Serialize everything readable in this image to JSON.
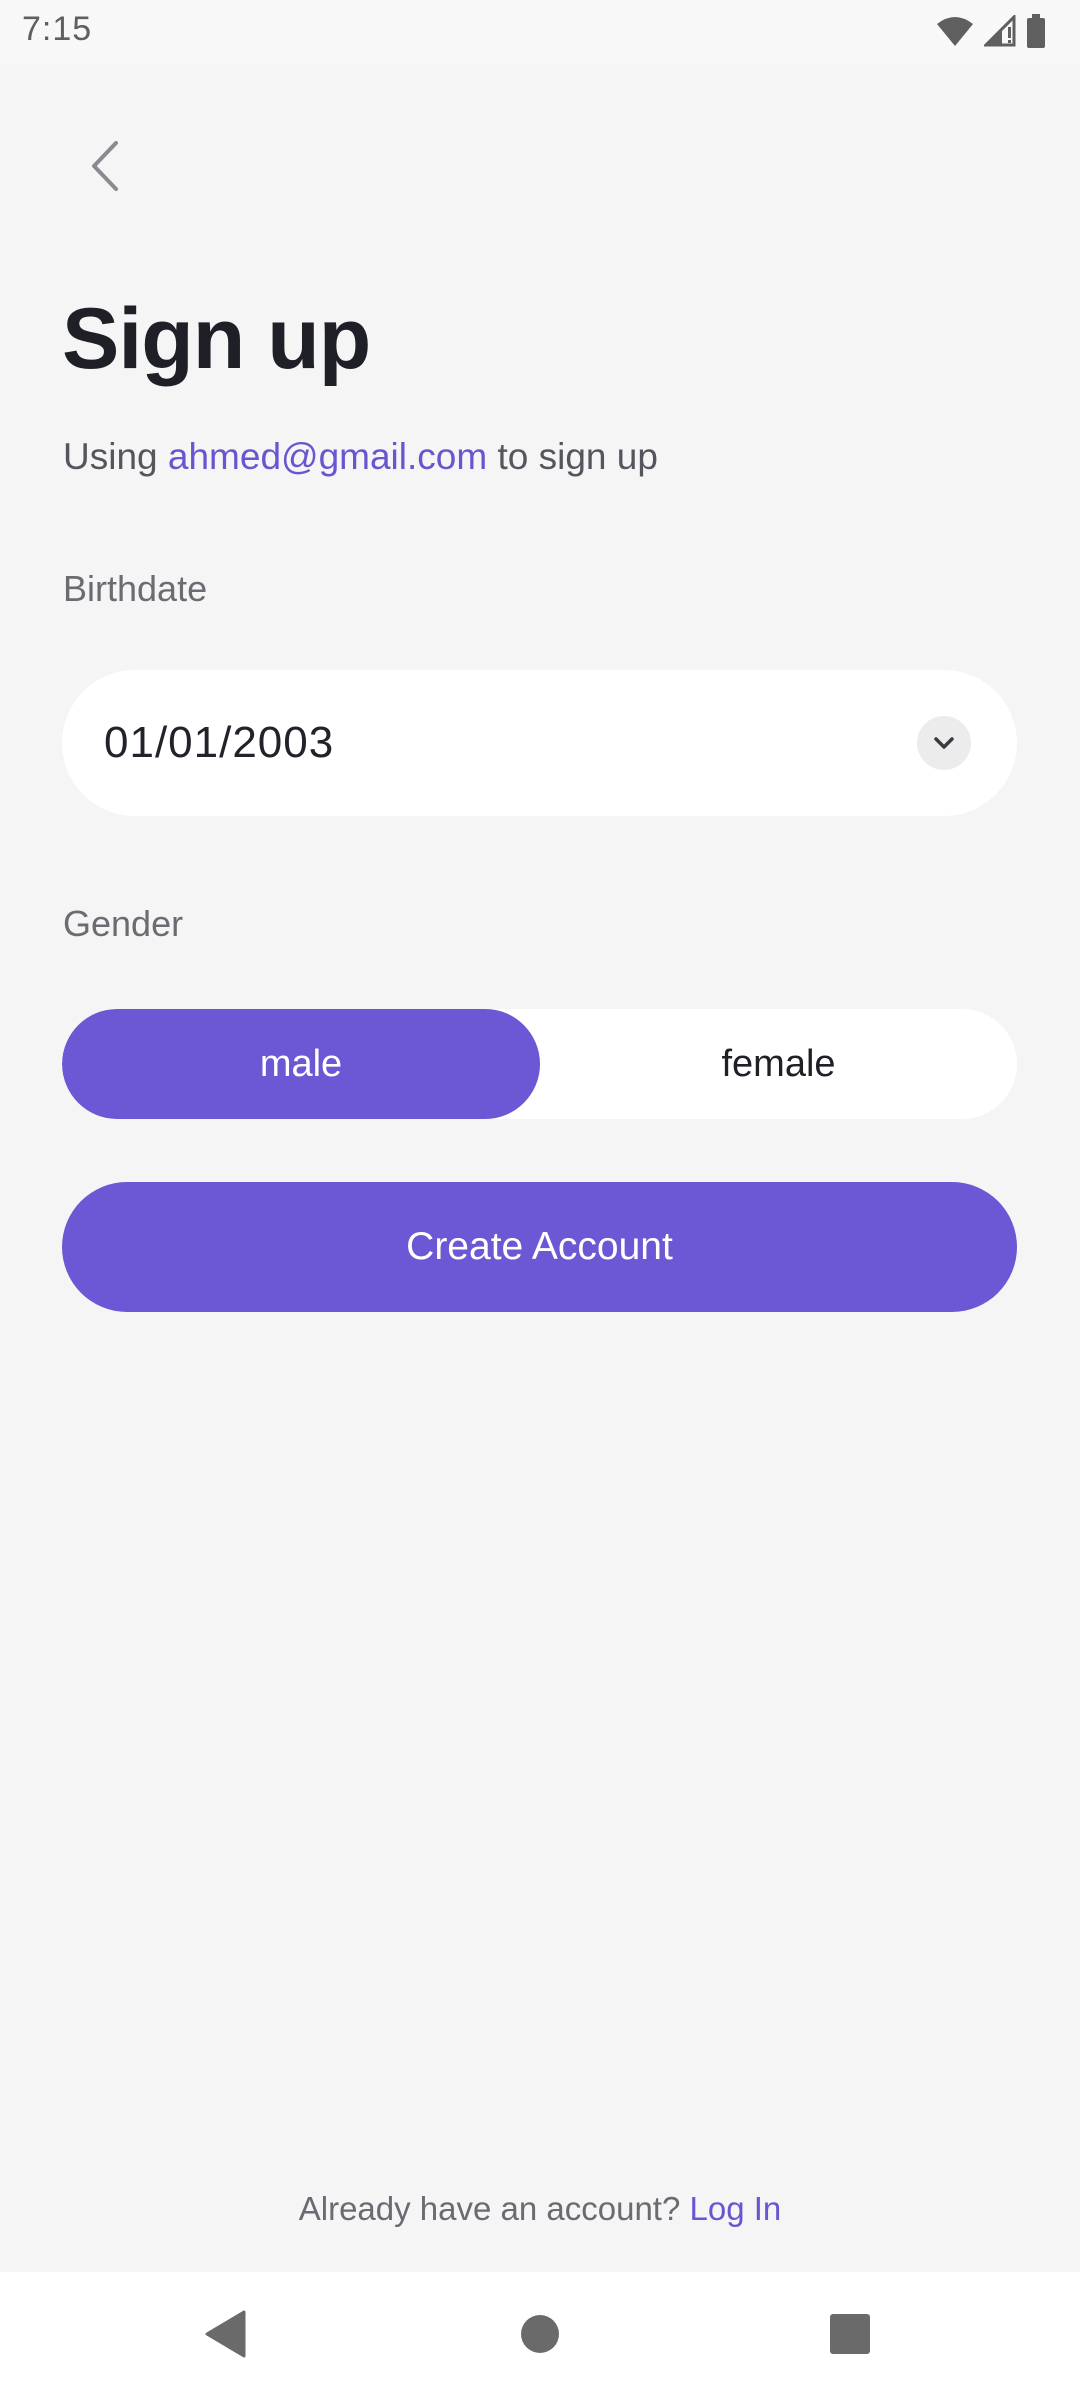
{
  "status_bar": {
    "time": "7:15",
    "icons": [
      "wifi-icon",
      "signal-icon",
      "battery-icon"
    ]
  },
  "header": {
    "back_icon": "chevron-left-icon",
    "title": "Sign up",
    "subtitle_prefix": "Using ",
    "email": "ahmed@gmail.com",
    "subtitle_suffix": " to sign up"
  },
  "birthdate": {
    "label": "Birthdate",
    "value": "01/01/2003",
    "dropdown_icon": "chevron-down-icon"
  },
  "gender": {
    "label": "Gender",
    "options": [
      "male",
      "female"
    ],
    "selected": "male"
  },
  "actions": {
    "create_account_label": "Create Account"
  },
  "footer": {
    "prompt": "Already have an account? ",
    "login_label": "Log In"
  },
  "nav_bar": {
    "icons": [
      "back-triangle-icon",
      "home-circle-icon",
      "recents-square-icon"
    ]
  },
  "colors": {
    "accent": "#6c57d5",
    "link": "#6a55d0",
    "background": "#f5f5f5"
  }
}
